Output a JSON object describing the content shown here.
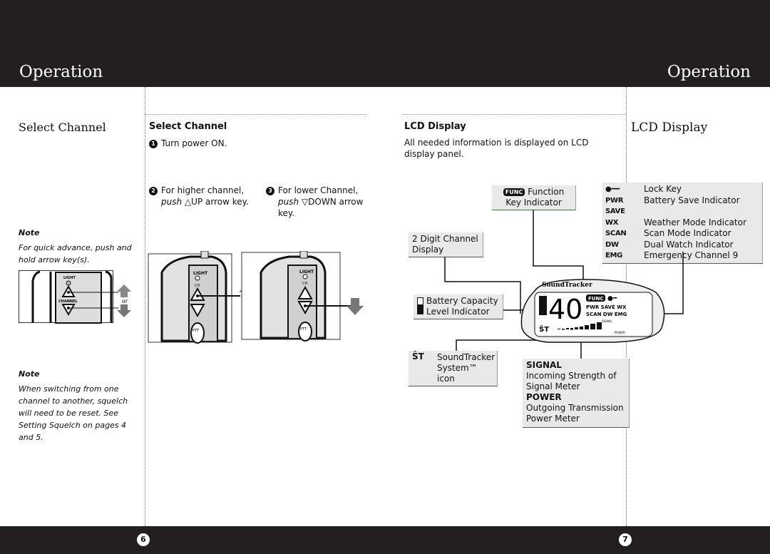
{
  "header": {
    "left_title": "Operation",
    "right_title": "Operation"
  },
  "left_page": {
    "side_title": "Select Channel",
    "note1": {
      "label": "Note",
      "text": "For quick advance, push and hold arrow key(s)."
    },
    "note1_or": "or",
    "note2": {
      "label": "Note",
      "text": "When switching from one channel to another, squelch will need to be reset. See Setting Squelch on pages 4 and 5."
    },
    "heading": "Select Channel",
    "steps": [
      {
        "num": "1",
        "text": "Turn power ON."
      },
      {
        "num": "2",
        "text": "For higher channel,",
        "push": "push",
        "key": "UP arrow key."
      },
      {
        "num": "3",
        "text": "For lower Channel,",
        "push": "push",
        "key": "DOWN arrow key."
      }
    ],
    "radio_labels": {
      "light": "LIGHT",
      "channel": "CHANNEL",
      "ch": "CH",
      "ptt": "PTT"
    },
    "page_number": "6"
  },
  "right_page": {
    "heading": "LCD Display",
    "intro": "All needed information is displayed on LCD display panel.",
    "side_title": "LCD Display",
    "callouts": {
      "func_icon": "FUNC",
      "func": "Function Key Indicator",
      "channel": "2 Digit Channel Display",
      "battery": "Battery Capacity Level Indicator",
      "soundtracker": "SoundTracker System™ icon",
      "signal_title": "SIGNAL",
      "signal": "Incoming Strength of Signal Meter",
      "power_title": "POWER",
      "power": "Outgoing Transmission Power Meter"
    },
    "indicators": [
      {
        "key": "lock-key-icon",
        "label": "Lock Key"
      },
      {
        "key": "PWR SAVE",
        "label": "Battery Save Indicator"
      },
      {
        "key": "WX",
        "label": "Weather Mode Indicator"
      },
      {
        "key": "SCAN",
        "label": "Scan Mode Indicator"
      },
      {
        "key": "DW",
        "label": "Dual Watch Indicator"
      },
      {
        "key": "EMG",
        "label": "Emergency Channel 9"
      }
    ],
    "lcd": {
      "brand": "SoundTracker",
      "channel": "40",
      "func": "FUNC",
      "row1": "PWR SAVE WX",
      "row2": "SCAN DW EMG",
      "signal": "SIGNAL",
      "power": "POWER",
      "signal_ticks": [
        "1",
        "3",
        "5",
        "9"
      ],
      "power_ticks": [
        "0.5",
        "1",
        "2",
        "3",
        "4"
      ]
    },
    "page_number": "7"
  }
}
